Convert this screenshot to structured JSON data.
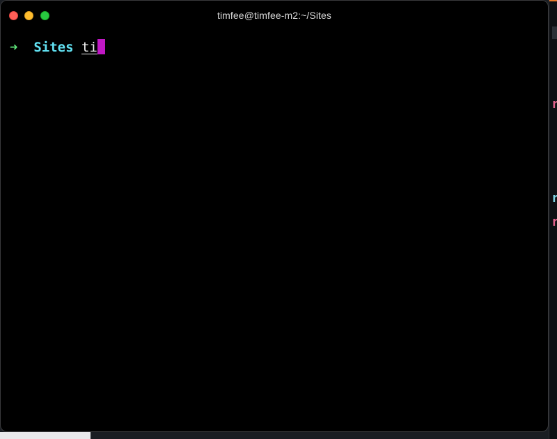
{
  "window": {
    "title": "timfee@timfee-m2:~/Sites"
  },
  "terminal": {
    "prompt_symbol": "➜",
    "current_directory": "Sites",
    "typed_input": "ti"
  },
  "colors": {
    "prompt_arrow": "#5fe67a",
    "directory": "#61e1f2",
    "cursor": "#c018c4",
    "background": "#000000",
    "close": "#ff5f57",
    "minimize": "#febc2e",
    "maximize": "#28c840"
  },
  "background_window": {
    "glyph_1": "r",
    "glyph_2": "r",
    "glyph_3": "r"
  }
}
